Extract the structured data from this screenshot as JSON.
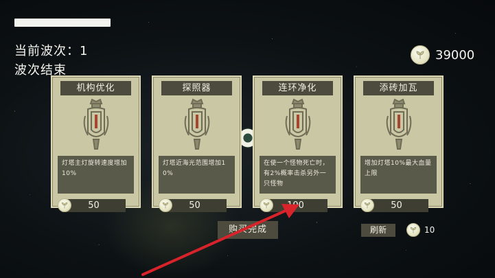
{
  "hud": {
    "wave_label": "当前波次：1",
    "wave_status": "波次结束",
    "coins": "39000"
  },
  "cards": [
    {
      "title": "机构优化",
      "desc": "灯塔主灯旋转速度增加10%",
      "price": "50"
    },
    {
      "title": "探照器",
      "desc": "灯塔近海光范围增加10%",
      "price": "50"
    },
    {
      "title": "连环净化",
      "desc": "在使一个怪物死亡时，有2%概率击杀另外一只怪物",
      "price": "100"
    },
    {
      "title": "添砖加瓦",
      "desc": "增加灯塔10%最大血量上限",
      "price": "50"
    }
  ],
  "actions": {
    "confirm_label": "购买完成",
    "refresh_label": "刷新",
    "refresh_cost": "10"
  },
  "colors": {
    "card_bg": "#c9c7a4",
    "dark_panel": "#4c4b3d",
    "arrow": "#d8232a"
  },
  "icons": [
    "coin-leaf-icon",
    "lighthouse-tower-icon",
    "red-arrow-annotation"
  ]
}
